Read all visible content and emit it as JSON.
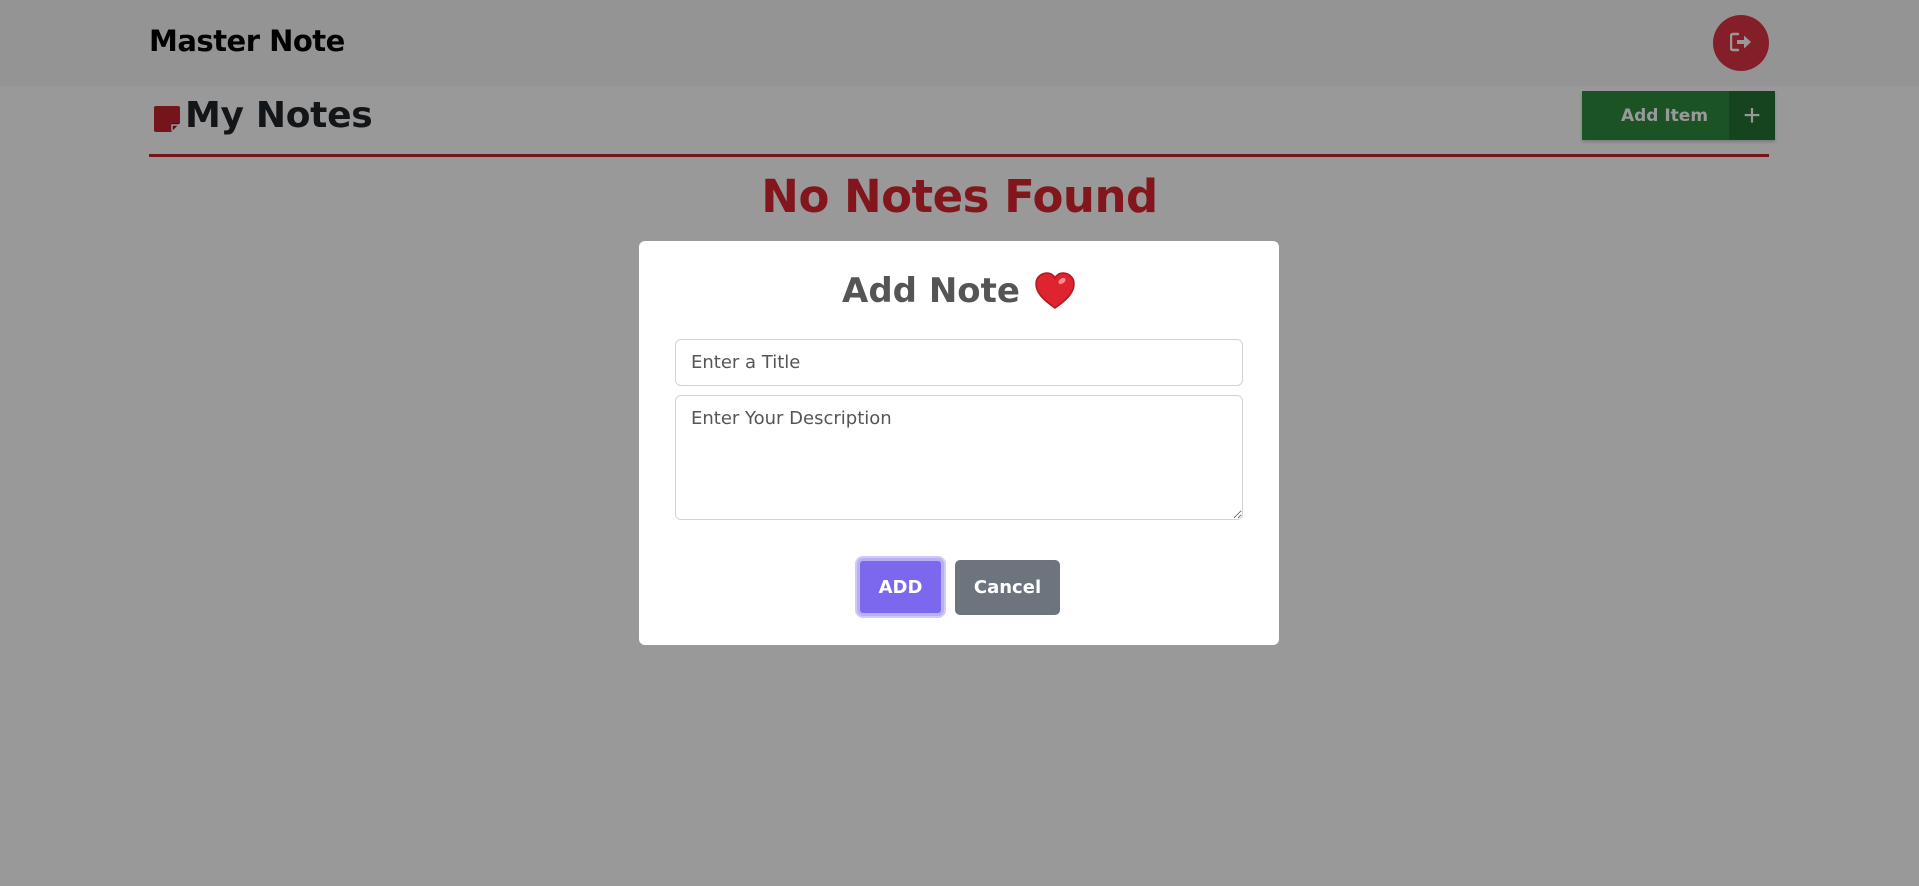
{
  "navbar": {
    "brand": "Master Note",
    "logout_icon": "sign-out-icon"
  },
  "header": {
    "title": "My Notes",
    "title_icon": "sticky-note-icon",
    "add_item_label": "Add Item",
    "add_item_icon": "plus-icon"
  },
  "main": {
    "empty_message": "No Notes Found"
  },
  "modal": {
    "title": "Add Note",
    "title_emoji": "heart-icon",
    "title_placeholder": "Enter a Title",
    "title_value": "",
    "description_placeholder": "Enter Your Description",
    "description_value": "",
    "add_label": "ADD",
    "cancel_label": "Cancel"
  },
  "colors": {
    "danger": "#dc3545",
    "success": "#2e8b3e",
    "primary": "#7b68ee",
    "secondary": "#6c757d",
    "empty_text": "#d9262f"
  }
}
